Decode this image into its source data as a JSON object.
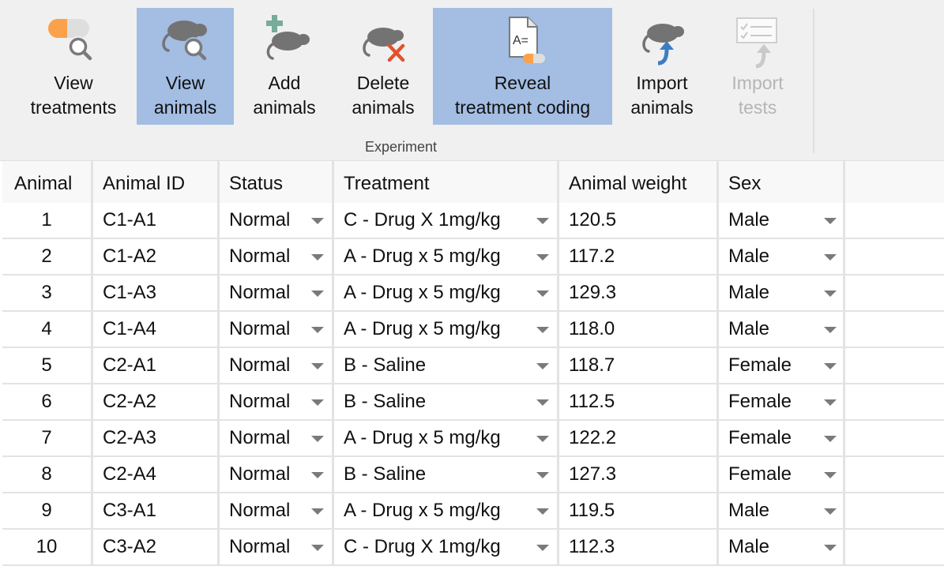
{
  "ribbon": {
    "group_label": "Experiment",
    "buttons": [
      {
        "id": "view-treatments",
        "line1": "View",
        "line2": "treatments",
        "icon": "pill-search-icon",
        "selected": false,
        "disabled": false
      },
      {
        "id": "view-animals",
        "line1": "View",
        "line2": "animals",
        "icon": "mouse-search-icon",
        "selected": true,
        "disabled": false
      },
      {
        "id": "add-animals",
        "line1": "Add",
        "line2": "animals",
        "icon": "mouse-add-icon",
        "selected": false,
        "disabled": false
      },
      {
        "id": "delete-animals",
        "line1": "Delete",
        "line2": "animals",
        "icon": "mouse-delete-icon",
        "selected": false,
        "disabled": false
      },
      {
        "id": "reveal-treatment-coding",
        "line1": "Reveal",
        "line2": "treatment coding",
        "icon": "document-code-pill-icon",
        "selected": true,
        "disabled": false
      },
      {
        "id": "import-animals",
        "line1": "Import",
        "line2": "animals",
        "icon": "mouse-import-icon",
        "selected": false,
        "disabled": false
      },
      {
        "id": "import-tests",
        "line1": "Import",
        "line2": "tests",
        "icon": "checklist-import-icon",
        "selected": false,
        "disabled": true
      }
    ],
    "colors": {
      "selected_bg": "#a3bde3",
      "pill_orange": "#fba14c",
      "mouse_gray": "#737373",
      "add_green": "#78ab9a",
      "delete_red": "#e2512e",
      "import_blue": "#3b7ec2"
    }
  },
  "table": {
    "columns": [
      "Animal",
      "Animal ID",
      "Status",
      "Treatment",
      "Animal weight",
      "Sex"
    ],
    "rows": [
      {
        "animal": "1",
        "id": "C1-A1",
        "status": "Normal",
        "treatment": "C - Drug X 1mg/kg",
        "weight": "120.5",
        "sex": "Male"
      },
      {
        "animal": "2",
        "id": "C1-A2",
        "status": "Normal",
        "treatment": "A - Drug x 5 mg/kg",
        "weight": "117.2",
        "sex": "Male"
      },
      {
        "animal": "3",
        "id": "C1-A3",
        "status": "Normal",
        "treatment": "A - Drug x 5 mg/kg",
        "weight": "129.3",
        "sex": "Male"
      },
      {
        "animal": "4",
        "id": "C1-A4",
        "status": "Normal",
        "treatment": "A - Drug x 5 mg/kg",
        "weight": "118.0",
        "sex": "Male"
      },
      {
        "animal": "5",
        "id": "C2-A1",
        "status": "Normal",
        "treatment": "B - Saline",
        "weight": "118.7",
        "sex": "Female"
      },
      {
        "animal": "6",
        "id": "C2-A2",
        "status": "Normal",
        "treatment": "B - Saline",
        "weight": "112.5",
        "sex": "Female"
      },
      {
        "animal": "7",
        "id": "C2-A3",
        "status": "Normal",
        "treatment": "A - Drug x 5 mg/kg",
        "weight": "122.2",
        "sex": "Female"
      },
      {
        "animal": "8",
        "id": "C2-A4",
        "status": "Normal",
        "treatment": "B - Saline",
        "weight": "127.3",
        "sex": "Female"
      },
      {
        "animal": "9",
        "id": "C3-A1",
        "status": "Normal",
        "treatment": "A - Drug x 5 mg/kg",
        "weight": "119.5",
        "sex": "Male"
      },
      {
        "animal": "10",
        "id": "C3-A2",
        "status": "Normal",
        "treatment": "C - Drug X 1mg/kg",
        "weight": "112.3",
        "sex": "Male"
      }
    ]
  }
}
